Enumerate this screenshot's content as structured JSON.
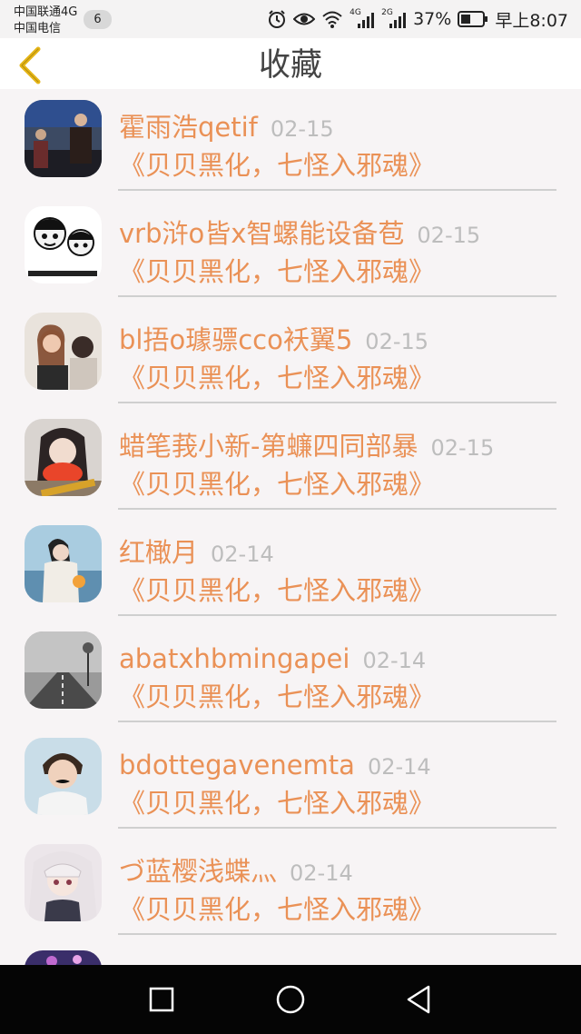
{
  "status_bar": {
    "carrier_1": "中国联通4G",
    "carrier_2": "中国电信",
    "notification_count": "6",
    "net_1": "4G",
    "net_2": "2G",
    "battery": "37%",
    "time": "早上8:07",
    "icons": [
      "alarm-icon",
      "eye-icon",
      "wifi-icon",
      "signal-icon",
      "signal-icon",
      "battery-icon"
    ]
  },
  "header": {
    "title": "收藏",
    "back_icon": "chevron-left-icon",
    "accent": "#e6b619"
  },
  "colors": {
    "name_text": "#ea9156",
    "date_text": "#bdbdbd",
    "background": "#f7f4f5"
  },
  "items": [
    {
      "name": "霍雨浩qetif",
      "date": "02-15",
      "title": "《贝贝黑化，七怪入邪魂》"
    },
    {
      "name": "vrb浒o皆x智螺能设备苞",
      "date": "02-15",
      "title": "《贝贝黑化，七怪入邪魂》"
    },
    {
      "name": "bl捂o璩骠cco袄翼5",
      "date": "02-15",
      "title": "《贝贝黑化，七怪入邪魂》"
    },
    {
      "name": "蜡笔莪小新-第蠊四同部暴",
      "date": "02-15",
      "title": "《贝贝黑化，七怪入邪魂》"
    },
    {
      "name": "红橄月",
      "date": "02-14",
      "title": "《贝贝黑化，七怪入邪魂》"
    },
    {
      "name": "abatxhbmingapei",
      "date": "02-14",
      "title": "《贝贝黑化，七怪入邪魂》"
    },
    {
      "name": "bdottegavenemta",
      "date": "02-14",
      "title": "《贝贝黑化，七怪入邪魂》"
    },
    {
      "name": "づ蓝樱浅蝶灬",
      "date": "02-14",
      "title": "《贝贝黑化，七怪入邪魂》"
    }
  ],
  "nav_bar": {
    "icons": [
      "recent-apps-icon",
      "home-icon",
      "back-triangle-icon"
    ]
  }
}
